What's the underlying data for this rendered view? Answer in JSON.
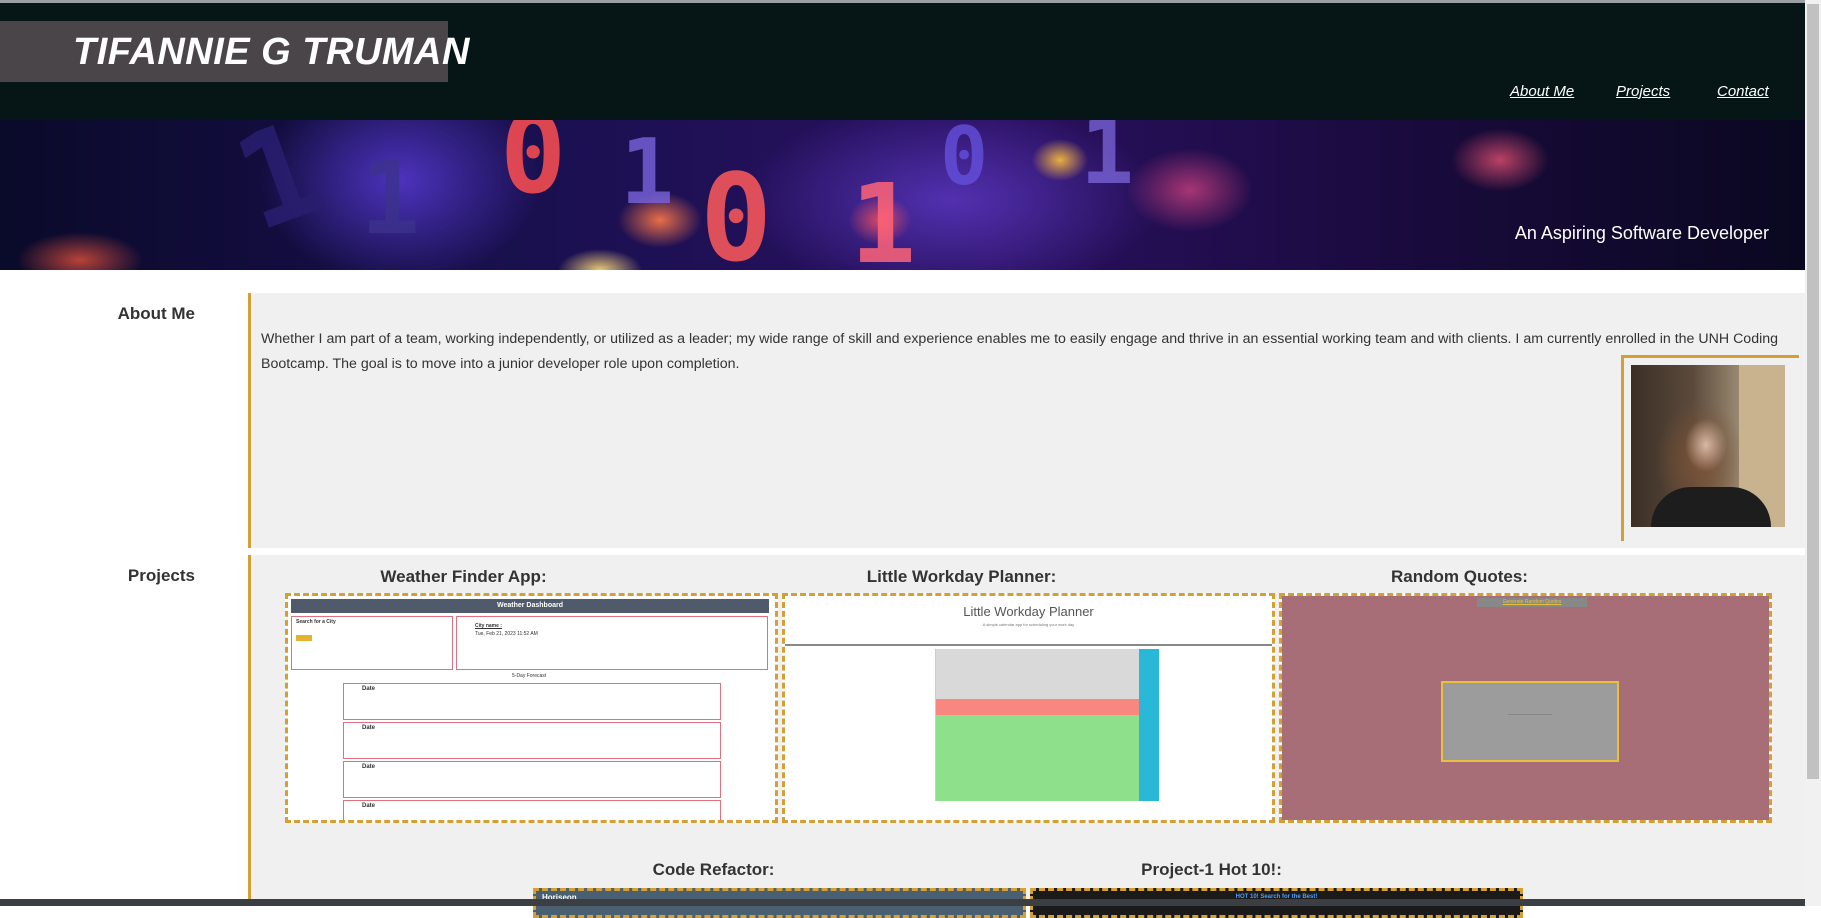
{
  "header": {
    "name": "TIFANNIE G TRUMAN",
    "nav": [
      {
        "label": "About Me"
      },
      {
        "label": "Projects"
      },
      {
        "label": "Contact"
      }
    ]
  },
  "hero": {
    "tagline": "An Aspiring Software Developer"
  },
  "about": {
    "title": "About Me",
    "text": "Whether I am part of a team, working independently, or utilized as a leader; my wide range of skill and experience enables me to easily engage and thrive in an essential working team and with clients. I am currently enrolled in the UNH Coding Bootcamp. The goal is to move into a junior developer role upon completion."
  },
  "projects": {
    "title": "Projects",
    "items": [
      {
        "title": "Weather Finder App:"
      },
      {
        "title": "Little Workday Planner:"
      },
      {
        "title": "Random Quotes:"
      },
      {
        "title": "Code Refactor:"
      },
      {
        "title": "Project-1 Hot 10!:"
      }
    ]
  },
  "mock_weather": {
    "header": "Weather Dashboard",
    "search_label": "Search for a City",
    "city_label": "City name :",
    "date_text": "Tue, Feb 21, 2023 11:52 AM",
    "forecast_label": "5-Day Forecast",
    "card_label": "Date"
  },
  "mock_planner": {
    "title": "Little Workday Planner",
    "subtitle": "A simple calendar app for scheduling your work day"
  },
  "mock_quotes": {
    "button": "Generate Random Quotes"
  },
  "mock_refactor": {
    "brand": "Horiseon"
  },
  "mock_hot10": {
    "link": "HOT 10! Search for the Best!"
  },
  "colors": {
    "accent": "#d4a035",
    "header_bg": "#061617",
    "brand_bg": "#4a4548",
    "section_bg": "#f0f0f0"
  }
}
